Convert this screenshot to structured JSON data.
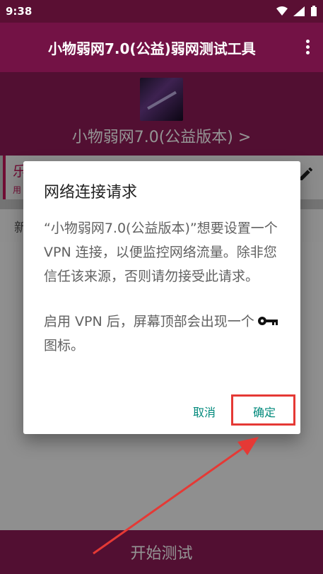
{
  "status_bar": {
    "time": "9:38",
    "icons": [
      "wifi-icon",
      "signal-icon",
      "battery-icon"
    ]
  },
  "app_bar": {
    "title": "小物弱网7.0(公益)弱网测试工具",
    "overflow_icon": "more-vert-icon"
  },
  "header": {
    "subtitle": "小物弱网7.0(公益版本) >"
  },
  "card": {
    "title": "乐",
    "subtitle": "用",
    "edit_icon": "pencil-icon"
  },
  "list_row": {
    "text": "新"
  },
  "bottom_bar": {
    "label": "开始测试"
  },
  "dialog": {
    "title": "网络连接请求",
    "body_1": "“小物弱网7.0(公益版本)”想要设置一个 VPN 连接，以便监控网络流量。除非您信任该来源，否则请勿接受此请求。",
    "body_2_prefix": "启用 VPN 后，屏幕顶部会出现一个",
    "body_2_suffix": "图标。",
    "key_icon": "key-icon",
    "cancel_label": "取消",
    "confirm_label": "确定"
  },
  "colors": {
    "status_bar": "#5a0f33",
    "app_bar": "#731245",
    "accent": "#8e1a56",
    "dialog_button": "#00897b",
    "highlight": "#e53935"
  }
}
